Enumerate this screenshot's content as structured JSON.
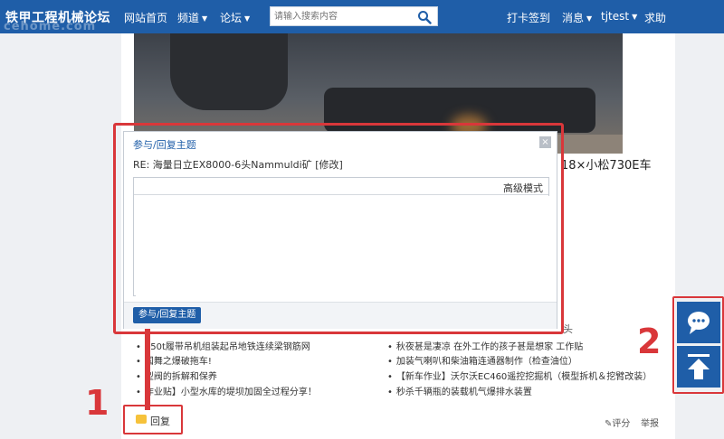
{
  "header": {
    "logo": "铁甲工程机械论坛",
    "watermark": "cehome.com",
    "nav": {
      "home": "网站首页",
      "channel": "频道",
      "forum": "论坛"
    },
    "search_placeholder": "请输入搜索内容",
    "right": {
      "checkin": "打卡签到",
      "messages": "消息",
      "user": "tjtest",
      "help": "求助"
    }
  },
  "post": {
    "title_fragment": "18×小松730E车",
    "related_header": "头"
  },
  "related": {
    "left": [
      "150t履带吊机组装起吊地铁连续梁钢筋网",
      "国舞之爆破拖车!",
      "型阀的拆解和保养",
      "作业贴】小型水库的堤坝加固全过程分享！"
    ],
    "right": [
      "秋夜甚是凄凉 在外工作的孩子甚是想家 工作贴",
      "加装气喇叭和柴油箱连通器制作（检查油位）",
      "【新车作业】沃尔沃EC460遥控挖掘机（模型拆机＆挖臂改装）",
      "秒杀千辆瓶的装载机气爆排水装置"
    ]
  },
  "actions": {
    "reply": "回复",
    "rate": "评分",
    "share": "举报"
  },
  "modal": {
    "title": "参与/回复主题",
    "close": "×",
    "subject": "RE: 海量日立EX8000-6头Nammuldi矿 [修改]",
    "advanced_mode": "高级模式",
    "submit": "参与/回复主题"
  },
  "annotations": {
    "one": "1",
    "two": "2"
  },
  "colors": {
    "nav_blue": "#1f5ea8",
    "highlight_red": "#d9373a"
  }
}
